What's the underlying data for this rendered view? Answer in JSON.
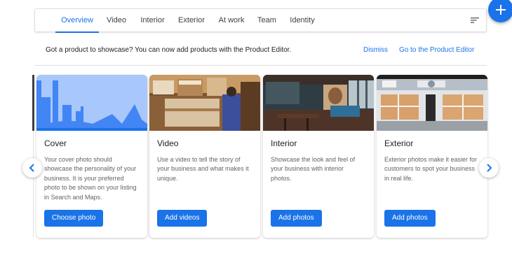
{
  "tabs": [
    {
      "label": "Overview"
    },
    {
      "label": "Video"
    },
    {
      "label": "Interior"
    },
    {
      "label": "Exterior"
    },
    {
      "label": "At work"
    },
    {
      "label": "Team"
    },
    {
      "label": "Identity"
    }
  ],
  "active_tab": "Overview",
  "fab_icon": "plus-icon",
  "filter_icon": "sort-icon",
  "banner": {
    "text": "Got a product to showcase? You can now add products with the Product Editor.",
    "dismiss": "Dismiss",
    "go_to_editor": "Go to the Product Editor"
  },
  "cards": [
    {
      "title": "Cover",
      "description": "Your cover photo should\nshowcase the personality of your\nbusiness. It is your preferred\nphoto to be shown on your listing\nin Search and Maps.",
      "button": "Choose photo"
    },
    {
      "title": "Video",
      "description": "Use a video to tell the story of\nyour business and what makes it\nunique.",
      "button": "Add videos"
    },
    {
      "title": "Interior",
      "description": "Showcase the look and feel of\nyour business with interior\nphotos.",
      "button": "Add photos"
    },
    {
      "title": "Exterior",
      "description": "Exterior photos make it easier for\ncustomers to spot your business\nin real life.",
      "button": "Add photos"
    }
  ],
  "colors": {
    "accent": "#1a73e8",
    "cover_bg": "#a8c7fa",
    "cover_shape": "#4285f4"
  }
}
